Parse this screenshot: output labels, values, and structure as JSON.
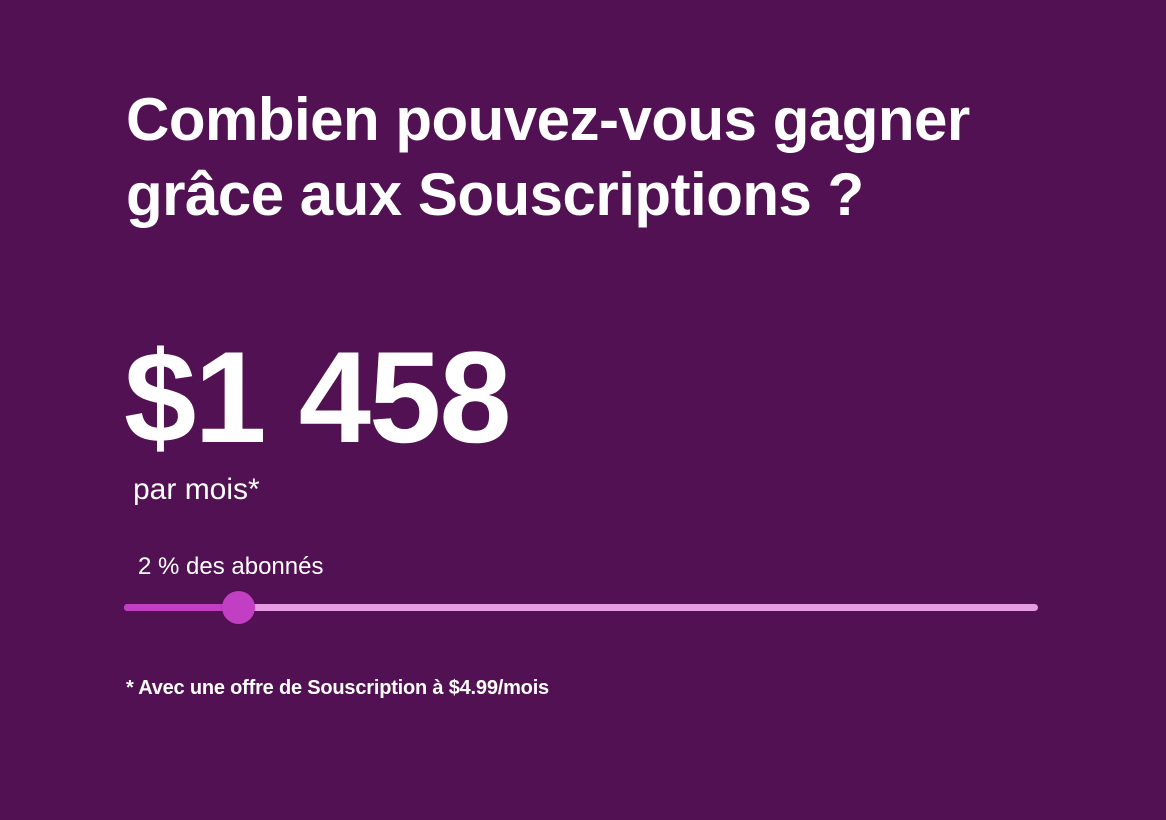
{
  "heading": {
    "line1": "Combien pouvez-vous gagner",
    "line2": "grâce aux Souscriptions ?"
  },
  "earnings": {
    "amount": "$1 458",
    "period": "par mois*"
  },
  "slider": {
    "label": "2 % des abonnés",
    "value_fraction": 0.125
  },
  "footnote": "* Avec une offre de Souscription à $4.99/mois",
  "colors": {
    "background": "#521152",
    "text": "#ffffff",
    "track": "#e69be3",
    "accent": "#c23fc4"
  }
}
